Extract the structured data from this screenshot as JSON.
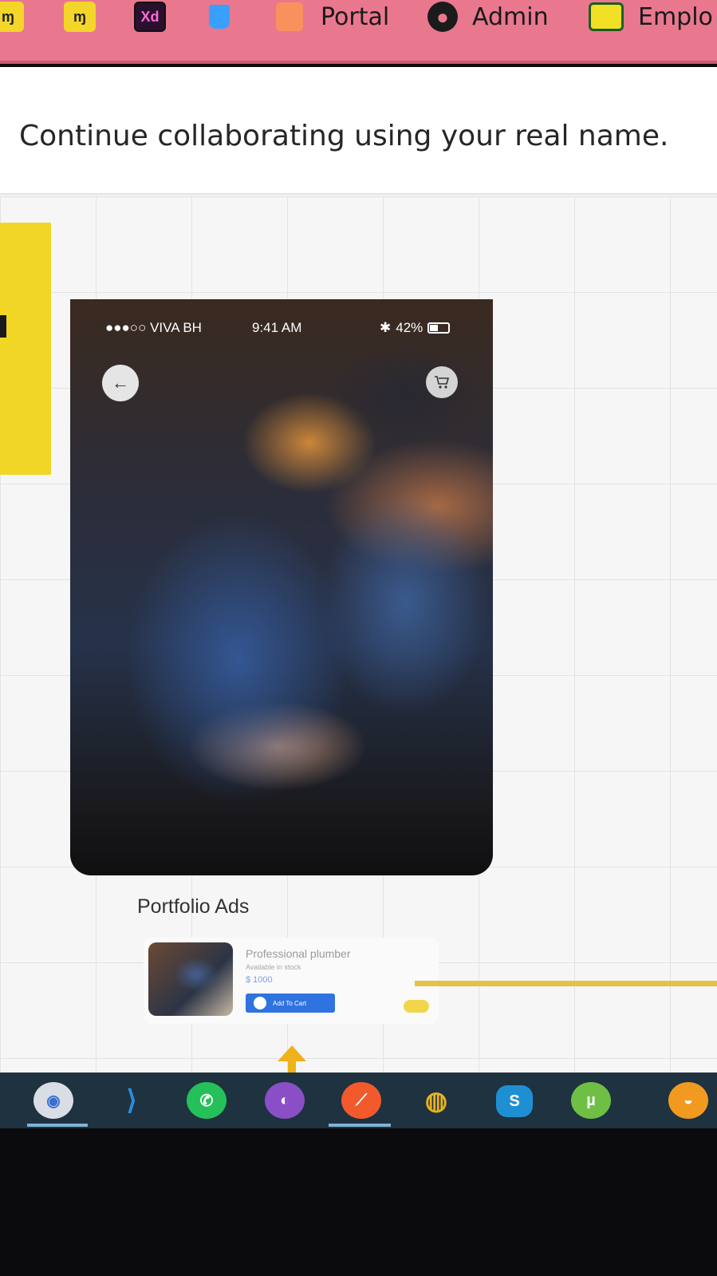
{
  "bookmarks": {
    "items": [
      {
        "icon": "m-logo-icon",
        "label": ""
      },
      {
        "icon": "m-logo-icon",
        "label": ""
      },
      {
        "icon": "xd-icon",
        "label": "",
        "icon_text": "Xd"
      },
      {
        "icon": "cup-icon",
        "label": ""
      },
      {
        "icon": "portal-icon",
        "label": "Portal"
      },
      {
        "icon": "globe-icon",
        "label": "Admin"
      },
      {
        "icon": "folder-icon",
        "label": "Emplo"
      }
    ]
  },
  "banner": {
    "text": "Continue collaborating using your real name."
  },
  "phone": {
    "status": {
      "carrier": "●●●○○ VIVA BH",
      "time": "9:41 AM",
      "battery": "42%"
    }
  },
  "portfolio": {
    "title": "Portfolio Ads",
    "card": {
      "name": "Professional plumber",
      "stock": "Available in stock",
      "price": "$ 1000",
      "button": "Add To Cart"
    }
  },
  "taskbar": {
    "apps": [
      "chrome-icon",
      "vscode-icon",
      "whatsapp-icon",
      "github-icon",
      "brave-icon",
      "chrome-canary-icon",
      "skype-icon",
      "utorrent-icon",
      "sublime-icon"
    ]
  },
  "colors": {
    "bookmarks_bar": "#e9788f",
    "taskbar": "#1e3240",
    "button_blue": "#2f73e0",
    "sticky_yellow": "#f1d626"
  }
}
